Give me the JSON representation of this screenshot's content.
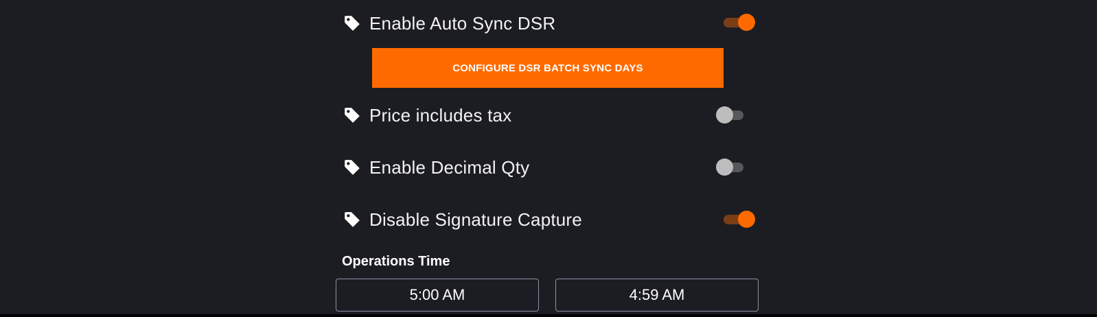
{
  "settings": {
    "auto_sync_dsr": {
      "label": "Enable Auto Sync DSR",
      "enabled": true,
      "icon": "tag-icon"
    },
    "configure_button_label": "CONFIGURE DSR BATCH SYNC DAYS",
    "price_includes_tax": {
      "label": "Price includes tax",
      "enabled": false,
      "icon": "tag-icon"
    },
    "enable_decimal_qty": {
      "label": "Enable Decimal Qty",
      "enabled": false,
      "icon": "tag-icon"
    },
    "disable_signature_capture": {
      "label": "Disable Signature Capture",
      "enabled": true,
      "icon": "tag-icon"
    }
  },
  "operations_time": {
    "title": "Operations Time",
    "start": "5:00 AM",
    "end": "4:59 AM"
  },
  "colors": {
    "accent": "#ff6a00",
    "background": "#1c1d22",
    "toggle_on_track": "#7a3e16",
    "toggle_off_track": "#55575d",
    "toggle_off_thumb": "#bdbdbd",
    "field_border": "#8a93a8"
  }
}
